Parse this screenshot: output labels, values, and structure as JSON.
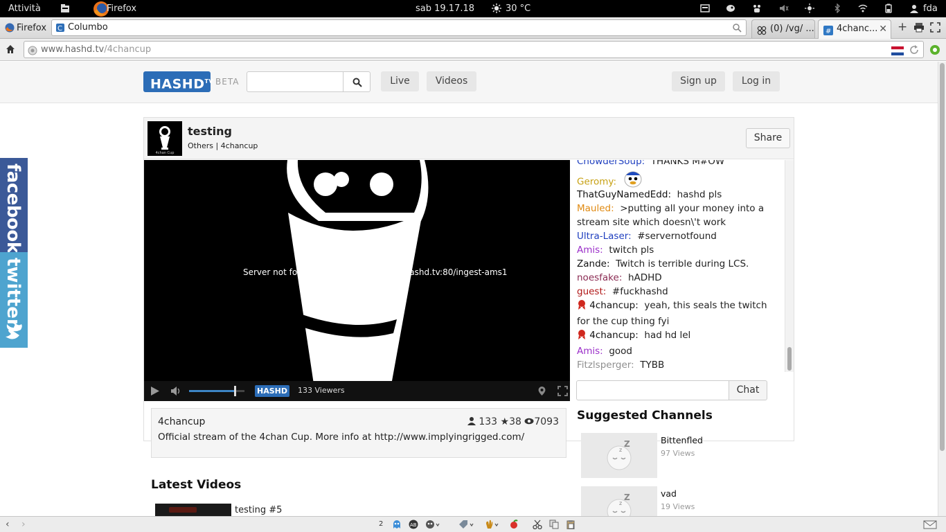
{
  "topbar": {
    "activities": "Attività",
    "app_name": "Firefox",
    "clock": "sab 19.17.18",
    "weather": "30 °C",
    "user": "fda"
  },
  "browser": {
    "menu_label": "Firefox",
    "search_engine": "Columbo",
    "tabs": [
      {
        "label": "(0) /vg/ ..."
      },
      {
        "label": "4chanc..."
      }
    ],
    "url_domain": "www.hashd.tv",
    "url_path": "/4chancup"
  },
  "site": {
    "logo": "HASHD",
    "logo_tv": "TV",
    "beta": "BETA",
    "nav": {
      "live": "Live",
      "videos": "Videos",
      "signup": "Sign up",
      "login": "Log in"
    }
  },
  "channel": {
    "title": "testing",
    "category": "Others",
    "name_link": "4chancup",
    "share": "Share",
    "avatar_caption": "4chan Cup"
  },
  "player": {
    "error": "Server not found: rtmpt://ingest-ams1.hashd.tv:80/ingest-ams1",
    "logo": "HASHD",
    "viewers": "133 Viewers",
    "volume_level": 0.82
  },
  "chat": {
    "messages": [
      {
        "user": "ChowderSoup:",
        "color": "#1f3fbf",
        "text": "THANKS M#OW"
      },
      {
        "user": "Geromy:",
        "color": "#c7a114",
        "text": "",
        "emote": true
      },
      {
        "user": "ThatGuyNamedEdd:",
        "color": "#111111",
        "text": "hashd pls"
      },
      {
        "user": "Mauled:",
        "color": "#e08a12",
        "text": ">putting all your money into a stream site which doesn\\'t work"
      },
      {
        "user": "Ultra-Laser:",
        "color": "#1f3fbf",
        "text": "#servernotfound"
      },
      {
        "user": "Amis:",
        "color": "#9b2fc9",
        "text": "twitch pls"
      },
      {
        "user": "Zande:",
        "color": "#111111",
        "text": "Twitch is terrible during LCS."
      },
      {
        "user": "noesfake:",
        "color": "#8a2a52",
        "text": "hADHD"
      },
      {
        "user": "guest:",
        "color": "#b01717",
        "text": "#fuckhashd"
      },
      {
        "user": "4chancup:",
        "color": "#111111",
        "text": "yeah, this seals the twitch for the cup thing fyi",
        "badge": true
      },
      {
        "user": "4chancup:",
        "color": "#111111",
        "text": "had hd lel",
        "badge": true
      },
      {
        "user": "Amis:",
        "color": "#9b2fc9",
        "text": "good"
      },
      {
        "user": "Fitzlsperger:",
        "color": "#8f8f8f",
        "text": "TYBB"
      }
    ],
    "send_label": "Chat"
  },
  "info": {
    "owner": "4chancup",
    "followers": "133",
    "stars": "★38",
    "views": "7093",
    "description": "Official stream of the 4chan Cup. More info at http://www.implyingrigged.com/"
  },
  "latest_videos": {
    "heading": "Latest Videos",
    "items": [
      {
        "title": "testing #5"
      }
    ]
  },
  "suggested": {
    "heading": "Suggested Channels",
    "items": [
      {
        "name": "Bittenfled",
        "views": "97 Views"
      },
      {
        "name": "vad",
        "views": "19 Views"
      }
    ]
  },
  "social": {
    "facebook": "facebook",
    "twitter": "twitter"
  },
  "addonbar": {
    "count": "2"
  }
}
